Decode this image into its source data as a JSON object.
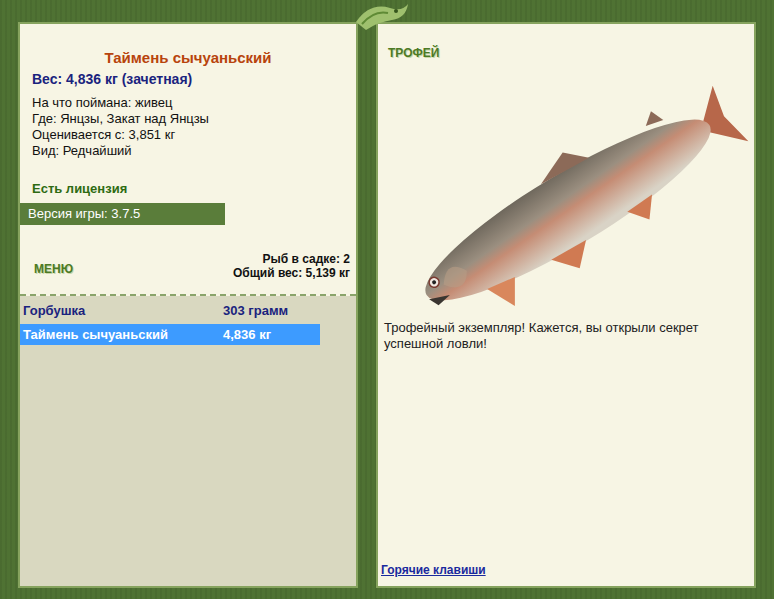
{
  "fish": {
    "title": "Таймень сычуаньский",
    "weight": "Вес: 4,836 кг (зачетная)",
    "details": [
      "На что поймана: живец",
      "Где: Янцзы, Закат над Янцзы",
      "Оценивается с: 3,851 кг",
      "Вид: Редчайший"
    ]
  },
  "license": "Есть лицензия",
  "version": "Версия игры: 3.7.5",
  "menu": "МЕНЮ",
  "keepnet": {
    "count": "Рыб в садке: 2",
    "total": "Общий вес: 5,139 кг"
  },
  "catch_list": [
    {
      "name": "Горбушка",
      "weight": "303 грамм",
      "selected": false
    },
    {
      "name": "Таймень сычуаньский",
      "weight": "4,836 кг",
      "selected": true
    }
  ],
  "trophy": {
    "label": "ТРОФЕЙ",
    "message": "Трофейный экземпляр! Кажется, вы открыли секрет успешной ловли!"
  },
  "hotkeys": "Горячие клавиши"
}
